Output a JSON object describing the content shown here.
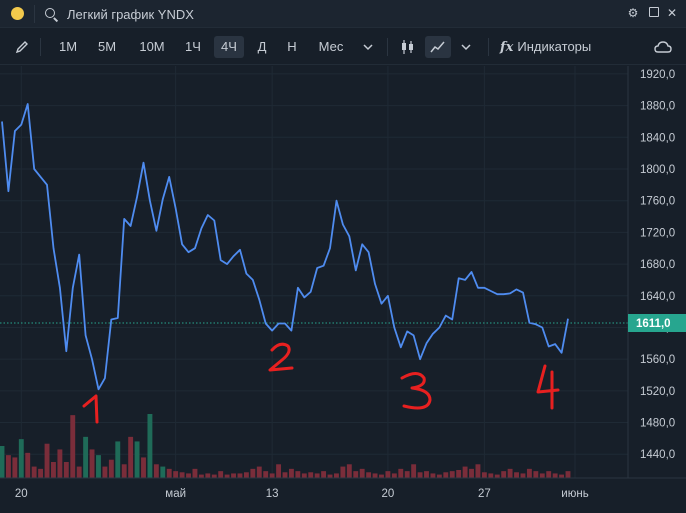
{
  "window": {
    "title": "Легкий график YNDX",
    "icons": [
      "gear-icon",
      "square-icon",
      "close-icon"
    ]
  },
  "toolbar": {
    "intervals": [
      "1М",
      "5М",
      "10М",
      "1Ч",
      "4Ч",
      "Д",
      "Н",
      "Мес"
    ],
    "active_interval": "4Ч",
    "indicators_label": "Индикаторы",
    "fx_label": "fx"
  },
  "colors": {
    "background": "#171f29",
    "line": "#4f8cf0",
    "price_tag": "#27a68f",
    "volume_up": "#1f6b58",
    "volume_down": "#7a2d3a",
    "annotation": "#e82020"
  },
  "chart_data": {
    "type": "line",
    "y_ticks": [
      "1920,0",
      "1880,0",
      "1840,0",
      "1800,0",
      "1760,0",
      "1720,0",
      "1680,0",
      "1640,0",
      "1600,0",
      "1560,0",
      "1520,0",
      "1480,0",
      "1440,0"
    ],
    "x_ticks": [
      "20",
      "май",
      "13",
      "20",
      "27",
      "июнь"
    ],
    "current_price": "1611,0",
    "ylim": [
      1410,
      1930
    ],
    "series": [
      {
        "values": [
          1860,
          1772,
          1848,
          1856,
          1882,
          1800,
          1790,
          1780,
          1700,
          1650,
          1570,
          1650,
          1692,
          1590,
          1560,
          1522,
          1536,
          1610,
          1612,
          1737,
          1728,
          1765,
          1808,
          1760,
          1722,
          1762,
          1790,
          1750,
          1705,
          1695,
          1700,
          1725,
          1742,
          1735,
          1685,
          1680,
          1690,
          1698,
          1668,
          1660,
          1635,
          1605,
          1596,
          1605,
          1605,
          1596,
          1650,
          1638,
          1645,
          1675,
          1678,
          1700,
          1760,
          1730,
          1715,
          1672,
          1705,
          1695,
          1655,
          1630,
          1640,
          1600,
          1575,
          1595,
          1590,
          1560,
          1580,
          1592,
          1600,
          1615,
          1610,
          1662,
          1660,
          1670,
          1650,
          1650,
          1646,
          1642,
          1642,
          1643,
          1648,
          1644,
          1606,
          1604,
          1600,
          1576,
          1579,
          1568,
          1611
        ],
        "volumes": [
          28,
          -20,
          -18,
          34,
          -22,
          -10,
          -8,
          -30,
          -14,
          -25,
          -14,
          -55,
          -10,
          36,
          -25,
          20,
          -10,
          -16,
          32,
          -12,
          -36,
          32,
          -18,
          56,
          -12,
          10,
          -8,
          -6,
          -5,
          -4,
          -8,
          -3,
          -4,
          -3,
          -6,
          -3,
          -4,
          -4,
          -5,
          -8,
          -10,
          -6,
          -4,
          -12,
          -5,
          -8,
          -6,
          -4,
          -5,
          -4,
          -6,
          -3,
          -4,
          -10,
          -12,
          -6,
          -8,
          -5,
          -4,
          -3,
          -6,
          -4,
          -8,
          -6,
          -12,
          -5,
          -6,
          -4,
          -3,
          -5,
          -6,
          -7,
          -10,
          -8,
          -12,
          -5,
          -4,
          -3,
          -6,
          -8,
          -5,
          -4,
          -8,
          -6,
          -4,
          -6,
          -4,
          -3,
          -6
        ]
      }
    ]
  },
  "annotations": [
    "1",
    "2",
    "3",
    "4"
  ]
}
